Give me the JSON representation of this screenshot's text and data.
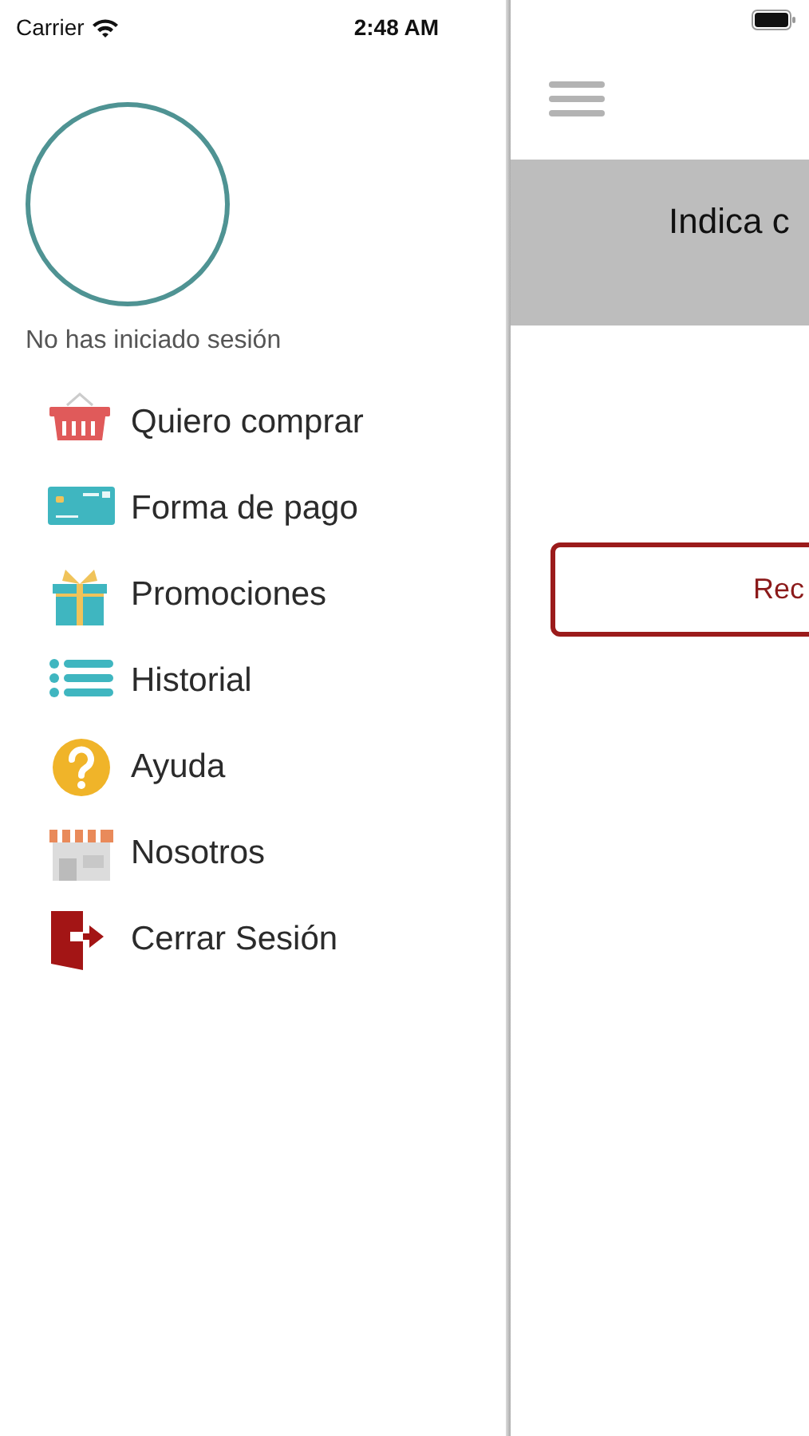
{
  "status_bar": {
    "carrier": "Carrier",
    "time": "2:48 AM"
  },
  "drawer": {
    "user_label": "No has iniciado sesión",
    "items": [
      {
        "label": "Quiero comprar",
        "kind": "basket"
      },
      {
        "label": "Forma de pago",
        "kind": "card"
      },
      {
        "label": "Promociones",
        "kind": "gift"
      },
      {
        "label": "Historial",
        "kind": "list"
      },
      {
        "label": "Ayuda",
        "kind": "help"
      },
      {
        "label": "Nosotros",
        "kind": "store"
      },
      {
        "label": "Cerrar Sesión",
        "kind": "exit"
      }
    ]
  },
  "main": {
    "banner_text": "Indica c",
    "button_label": "Rec"
  }
}
